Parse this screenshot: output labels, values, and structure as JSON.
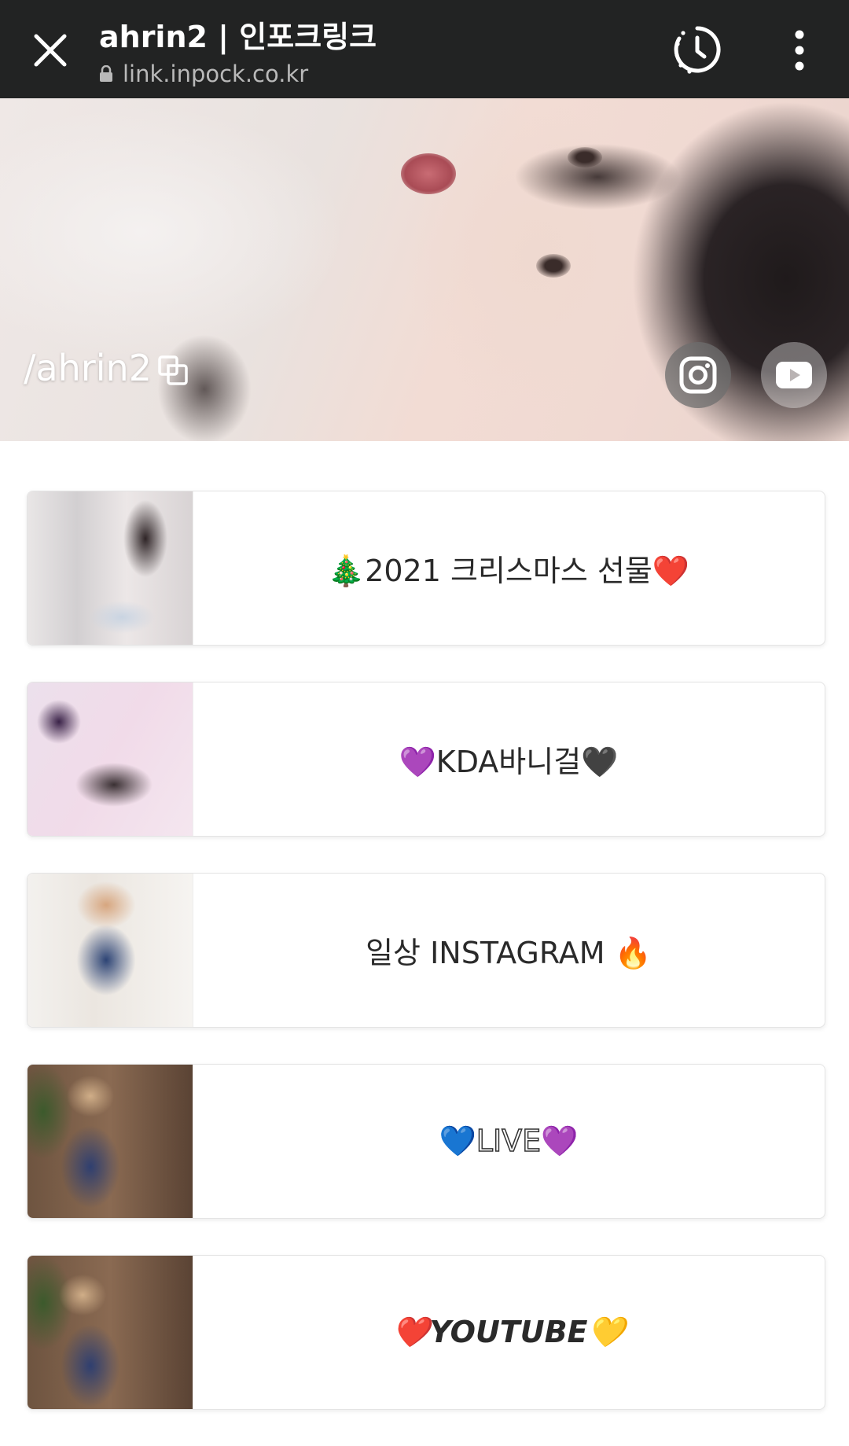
{
  "browser": {
    "title": "ahrin2 | 인포크링크",
    "url": "link.inpock.co.kr"
  },
  "profile": {
    "handle": "/ahrin2"
  },
  "links": [
    {
      "label": "🎄2021 크리스마스 선물❤️",
      "style": "normal"
    },
    {
      "label": "💜KDA바니걸🖤",
      "style": "normal"
    },
    {
      "label": "일상 INSTAGRAM 🔥",
      "style": "normal"
    },
    {
      "label": "💙LIVE💜",
      "style": "outline"
    },
    {
      "label": "❤️YOUTUBE💛",
      "style": "italic"
    }
  ],
  "icons": {
    "close": "close-icon",
    "history": "history-icon",
    "menu": "more-vertical-icon",
    "lock": "lock-icon",
    "copy": "copy-icon",
    "instagram": "instagram-icon",
    "youtube": "youtube-icon"
  },
  "colors": {
    "topbar": "#222323",
    "url_text": "#b9b9b9",
    "card_border": "#e4e4e4"
  }
}
